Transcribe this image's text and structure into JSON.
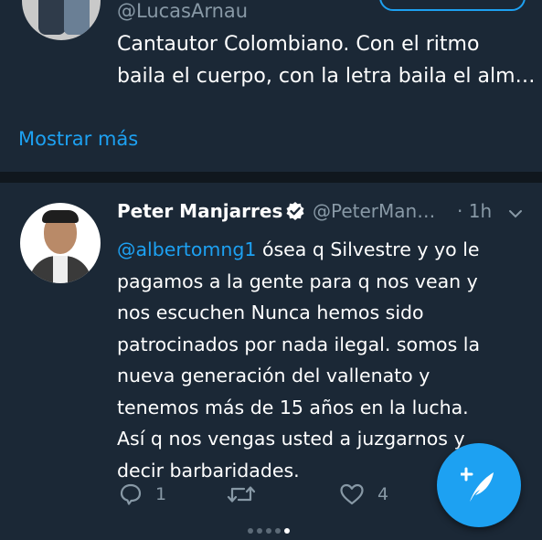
{
  "previous_tweet": {
    "handle": "@LucasArnau",
    "bio_line_1": "Cantautor Colombiano. Con el ritmo",
    "bio_line_2": "baila el cuerpo, con la letra baila el alm…"
  },
  "show_more_label": "Mostrar más",
  "tweet": {
    "author_name": "Peter Manjarres",
    "handle": "@PeterMan…",
    "time": "· 1h",
    "mention": "@albertomng1",
    "lines": [
      " ósea q Silvestre y yo le",
      "pagamos a la gente para q nos vean y",
      "nos escuchen Nunca hemos sido",
      "patrocinados por nada ilegal.  somos la",
      "nueva generación del vallenato y",
      "tenemos más de 15 años en la lucha.",
      "Así q nos vengas usted a juzgarnos y",
      "decir barbaridades."
    ],
    "reply_count": "1",
    "retweet_count": "",
    "like_count": "4"
  },
  "icons": {
    "verified": "verified-badge-icon",
    "caret": "chevron-down-icon",
    "reply": "reply-icon",
    "retweet": "retweet-icon",
    "like": "heart-icon",
    "compose": "compose-tweet-icon"
  },
  "pager": {
    "total": 5,
    "active_index": 4
  },
  "colors": {
    "background": "#1b2836",
    "separator": "#10171e",
    "accent": "#1da1f2",
    "muted": "#8899a6",
    "text": "#ffffff"
  }
}
